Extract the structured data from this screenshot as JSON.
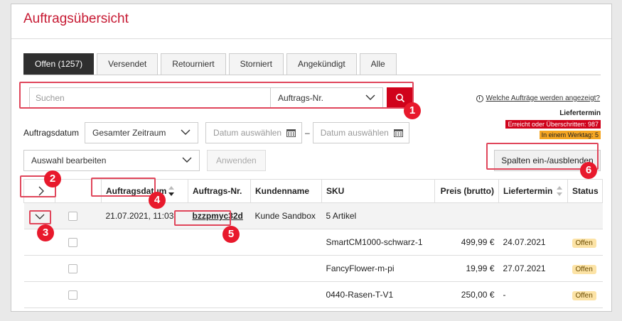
{
  "page": {
    "title": "Auftragsübersicht"
  },
  "tabs": [
    {
      "label": "Offen (1257)",
      "active": true
    },
    {
      "label": "Versendet"
    },
    {
      "label": "Retourniert"
    },
    {
      "label": "Storniert"
    },
    {
      "label": "Angekündigt"
    },
    {
      "label": "Alle"
    }
  ],
  "search": {
    "placeholder": "Suchen",
    "field": "Auftrags-Nr."
  },
  "info": {
    "link": "Welche Aufträge werden angezeigt?"
  },
  "liefertermin": {
    "title": "Liefertermin",
    "overdue": "Erreicht oder Überschritten: 987",
    "one_day": "In einem Werktag: 5"
  },
  "filters": {
    "date_label": "Auftragsdatum",
    "range": "Gesamter Zeitraum",
    "from_placeholder": "Datum auswählen",
    "to_placeholder": "Datum auswählen",
    "dash": "–"
  },
  "actions": {
    "select": "Auswahl bearbeiten",
    "apply": "Anwenden",
    "columns": "Spalten ein-/ausblenden"
  },
  "table": {
    "headers": {
      "date": "Auftragsdatum",
      "order": "Auftrags-Nr.",
      "customer": "Kundenname",
      "sku": "SKU",
      "price": "Preis (brutto)",
      "delivery": "Liefertermin",
      "status": "Status"
    },
    "group": {
      "date": "21.07.2021, 11:03",
      "order": "bzzpmyc32d",
      "customer": "Kunde Sandbox",
      "sku": "5 Artikel"
    },
    "items": [
      {
        "sku": "SmartCM1000-schwarz-1",
        "price": "499,99 €",
        "delivery": "24.07.2021",
        "status": "Offen"
      },
      {
        "sku": "FancyFlower-m-pi",
        "price": "19,99 €",
        "delivery": "27.07.2021",
        "status": "Offen"
      },
      {
        "sku": "0440-Rasen-T-V1",
        "price": "250,00 €",
        "delivery": "-",
        "status": "Offen"
      }
    ]
  },
  "callouts": [
    "1",
    "2",
    "3",
    "4",
    "5",
    "6"
  ],
  "colors": {
    "brand": "#c71a33",
    "primary_button": "#d0021b",
    "highlight": "#e0465b",
    "callout": "#e8192c",
    "status_open": "#fce3a6",
    "warning": "#f5a623"
  }
}
